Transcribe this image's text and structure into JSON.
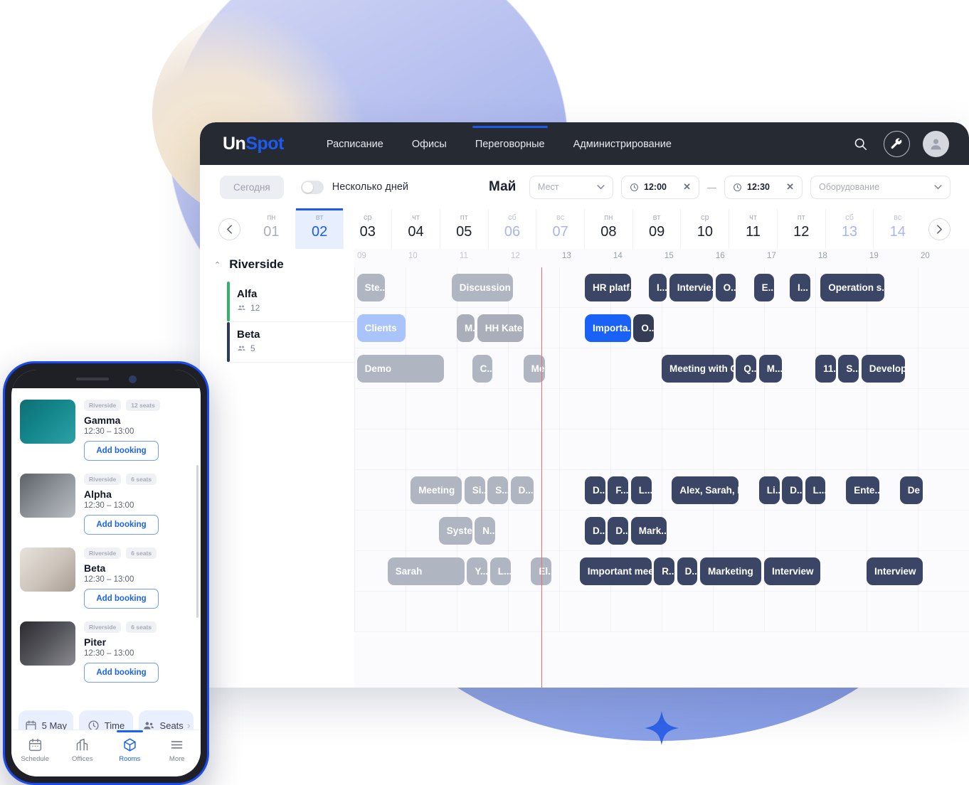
{
  "brand": {
    "part1": "Un",
    "part2": "Spot"
  },
  "nav": {
    "items": [
      {
        "label": "Расписание",
        "active": false
      },
      {
        "label": "Офисы",
        "active": false
      },
      {
        "label": "Переговорные",
        "active": true
      },
      {
        "label": "Администрирование",
        "active": false
      }
    ],
    "icons": {
      "search": "search-icon",
      "settings": "wrench-icon",
      "profile": "avatar-icon"
    }
  },
  "toolbar": {
    "today_label": "Сегодня",
    "multiday_label": "Несколько дней",
    "multiday_on": false,
    "month": "Май",
    "seats_placeholder": "Мест",
    "time_from": "12:00",
    "time_to": "12:30",
    "time_separator": "—",
    "equipment_placeholder": "Оборудование"
  },
  "dates": {
    "prev": "‹",
    "next": "›",
    "days": [
      {
        "dow": "пн",
        "num": "01",
        "state": "dim"
      },
      {
        "dow": "вт",
        "num": "02",
        "state": "selected"
      },
      {
        "dow": "ср",
        "num": "03",
        "state": "normal"
      },
      {
        "dow": "чт",
        "num": "04",
        "state": "normal"
      },
      {
        "dow": "пт",
        "num": "05",
        "state": "normal"
      },
      {
        "dow": "сб",
        "num": "06",
        "state": "weekend"
      },
      {
        "dow": "вс",
        "num": "07",
        "state": "weekend"
      },
      {
        "dow": "пн",
        "num": "08",
        "state": "normal"
      },
      {
        "dow": "вт",
        "num": "09",
        "state": "normal"
      },
      {
        "dow": "ср",
        "num": "10",
        "state": "normal"
      },
      {
        "dow": "чт",
        "num": "11",
        "state": "normal"
      },
      {
        "dow": "пт",
        "num": "12",
        "state": "normal"
      },
      {
        "dow": "сб",
        "num": "13",
        "state": "weekend"
      },
      {
        "dow": "вс",
        "num": "14",
        "state": "weekend"
      }
    ]
  },
  "schedule": {
    "group": {
      "name": "Riverside",
      "expanded": true
    },
    "rooms": [
      {
        "name": "Alfa",
        "seats": "12",
        "color": "#31b46a"
      },
      {
        "name": "Beta",
        "seats": "5",
        "color": "#2d3a5e"
      }
    ],
    "hours": [
      "09",
      "10",
      "11",
      "12",
      "13",
      "14",
      "15",
      "16",
      "17",
      "18",
      "19",
      "20"
    ],
    "now_hour": 12.65,
    "rows": [
      {
        "events": [
          {
            "label": "Ste...",
            "start": 9.05,
            "end": 9.6,
            "color": "gray"
          },
          {
            "label": "Discussion a...",
            "start": 10.9,
            "end": 12.1,
            "color": "gray"
          },
          {
            "label": "HR platf...",
            "start": 13.5,
            "end": 14.4,
            "color": "dark"
          },
          {
            "label": "I...",
            "start": 14.75,
            "end": 15.1,
            "color": "dark"
          },
          {
            "label": "Intervie...",
            "start": 15.15,
            "end": 16.0,
            "color": "dark"
          },
          {
            "label": "O...",
            "start": 16.05,
            "end": 16.45,
            "color": "dark"
          },
          {
            "label": "E...",
            "start": 16.8,
            "end": 17.2,
            "color": "dark"
          },
          {
            "label": "I...",
            "start": 17.5,
            "end": 17.9,
            "color": "dark"
          },
          {
            "label": "Operation s...",
            "start": 18.1,
            "end": 19.35,
            "color": "dark"
          }
        ]
      },
      {
        "events": [
          {
            "label": "Clients",
            "start": 9.05,
            "end": 10.0,
            "color": "lblue"
          },
          {
            "label": "M...",
            "start": 11.0,
            "end": 11.35,
            "color": "gray2"
          },
          {
            "label": "HH Kate",
            "start": 11.4,
            "end": 12.3,
            "color": "gray2"
          },
          {
            "label": "Importa...",
            "start": 13.5,
            "end": 14.4,
            "color": "blue"
          },
          {
            "label": "O...",
            "start": 14.45,
            "end": 14.85,
            "color": "dark2"
          }
        ]
      },
      {
        "events": [
          {
            "label": "Demo",
            "start": 9.05,
            "end": 10.75,
            "color": "gray"
          },
          {
            "label": "C...",
            "start": 11.3,
            "end": 11.7,
            "color": "gray"
          },
          {
            "label": "Meet",
            "start": 12.3,
            "end": 12.72,
            "color": "gray"
          },
          {
            "label": "Meeting with C...",
            "start": 15.0,
            "end": 16.4,
            "color": "dark"
          },
          {
            "label": "Q...",
            "start": 16.45,
            "end": 16.85,
            "color": "dark"
          },
          {
            "label": "M...",
            "start": 16.9,
            "end": 17.35,
            "color": "dark"
          },
          {
            "label": "11...",
            "start": 18.0,
            "end": 18.4,
            "color": "dark"
          },
          {
            "label": "S...",
            "start": 18.45,
            "end": 18.85,
            "color": "dark"
          },
          {
            "label": "Develop...",
            "start": 18.9,
            "end": 19.75,
            "color": "dark"
          }
        ]
      },
      {
        "events": []
      },
      {
        "events": []
      },
      {
        "events": [
          {
            "label": "Meeting",
            "start": 10.1,
            "end": 11.1,
            "color": "gray"
          },
          {
            "label": "Si...",
            "start": 11.15,
            "end": 11.55,
            "color": "gray"
          },
          {
            "label": "S...",
            "start": 11.6,
            "end": 12.0,
            "color": "gray"
          },
          {
            "label": "D...",
            "start": 12.05,
            "end": 12.5,
            "color": "gray"
          },
          {
            "label": "D...",
            "start": 13.5,
            "end": 13.9,
            "color": "dark"
          },
          {
            "label": "F...",
            "start": 13.95,
            "end": 14.35,
            "color": "dark"
          },
          {
            "label": "L...",
            "start": 14.4,
            "end": 14.8,
            "color": "dark"
          },
          {
            "label": "Alex, Sarah, Ra...",
            "start": 15.2,
            "end": 16.5,
            "color": "dark"
          },
          {
            "label": "Li...",
            "start": 16.9,
            "end": 17.3,
            "color": "dark"
          },
          {
            "label": "D...",
            "start": 17.35,
            "end": 17.75,
            "color": "dark"
          },
          {
            "label": "L...",
            "start": 17.8,
            "end": 18.2,
            "color": "dark"
          },
          {
            "label": "Ente...",
            "start": 18.6,
            "end": 19.25,
            "color": "dark"
          },
          {
            "label": "De",
            "start": 19.65,
            "end": 20.1,
            "color": "dark"
          }
        ]
      },
      {
        "events": [
          {
            "label": "Syste...",
            "start": 10.65,
            "end": 11.3,
            "color": "gray"
          },
          {
            "label": "N...",
            "start": 11.35,
            "end": 11.75,
            "color": "gray"
          },
          {
            "label": "D...",
            "start": 13.5,
            "end": 13.9,
            "color": "dark"
          },
          {
            "label": "D...",
            "start": 13.95,
            "end": 14.35,
            "color": "dark"
          },
          {
            "label": "Mark...",
            "start": 14.4,
            "end": 15.1,
            "color": "dark"
          }
        ]
      },
      {
        "events": [
          {
            "label": "Sarah",
            "start": 9.65,
            "end": 11.15,
            "color": "gray"
          },
          {
            "label": "Y...",
            "start": 11.2,
            "end": 11.6,
            "color": "gray"
          },
          {
            "label": "L...",
            "start": 11.65,
            "end": 12.05,
            "color": "gray"
          },
          {
            "label": "El...",
            "start": 12.45,
            "end": 12.85,
            "color": "gray"
          },
          {
            "label": "Important mee...",
            "start": 13.4,
            "end": 14.8,
            "color": "dark"
          },
          {
            "label": "R...",
            "start": 14.85,
            "end": 15.25,
            "color": "dark"
          },
          {
            "label": "D...",
            "start": 15.3,
            "end": 15.7,
            "color": "dark"
          },
          {
            "label": "Marketing",
            "start": 15.75,
            "end": 16.95,
            "color": "dark"
          },
          {
            "label": "Interview",
            "start": 17.0,
            "end": 18.1,
            "color": "dark"
          },
          {
            "label": "Interview",
            "start": 19.0,
            "end": 20.1,
            "color": "dark"
          }
        ]
      },
      {
        "events": []
      }
    ]
  },
  "phone": {
    "rooms": [
      {
        "office": "Riverside",
        "seats": "12 seats",
        "name": "Gamma",
        "time": "12:30 – 13:00",
        "button": "Add booking",
        "thumb": "teal-meeting-room"
      },
      {
        "office": "Riverside",
        "seats": "6 seats",
        "name": "Alpha",
        "time": "12:30 – 13:00",
        "button": "Add booking",
        "thumb": "glass-lobby-room"
      },
      {
        "office": "Riverside",
        "seats": "6 seats",
        "name": "Beta",
        "time": "12:30 – 13:00",
        "button": "Add booking",
        "thumb": "bright-office-room"
      },
      {
        "office": "Riverside",
        "seats": "6 seats",
        "name": "Piter",
        "time": "12:30 – 13:00",
        "button": "Add booking",
        "thumb": "dark-boardroom"
      }
    ],
    "chips": [
      {
        "label": "5 May",
        "icon": "calendar-icon"
      },
      {
        "label": "Time",
        "icon": "clock-icon"
      },
      {
        "label": "Seats",
        "icon": "people-icon"
      }
    ],
    "tabs": [
      {
        "label": "Schedule",
        "icon": "calendar-icon",
        "active": false
      },
      {
        "label": "Offices",
        "icon": "buildings-icon",
        "active": false
      },
      {
        "label": "Rooms",
        "icon": "cube-icon",
        "active": true
      },
      {
        "label": "More",
        "icon": "hamburger-icon",
        "active": false
      }
    ]
  },
  "colors": {
    "accent": "#1d5bf0",
    "dark_event": "#3b4565",
    "gray_event": "#b0b5c2",
    "now_line": "#ec6b72"
  }
}
